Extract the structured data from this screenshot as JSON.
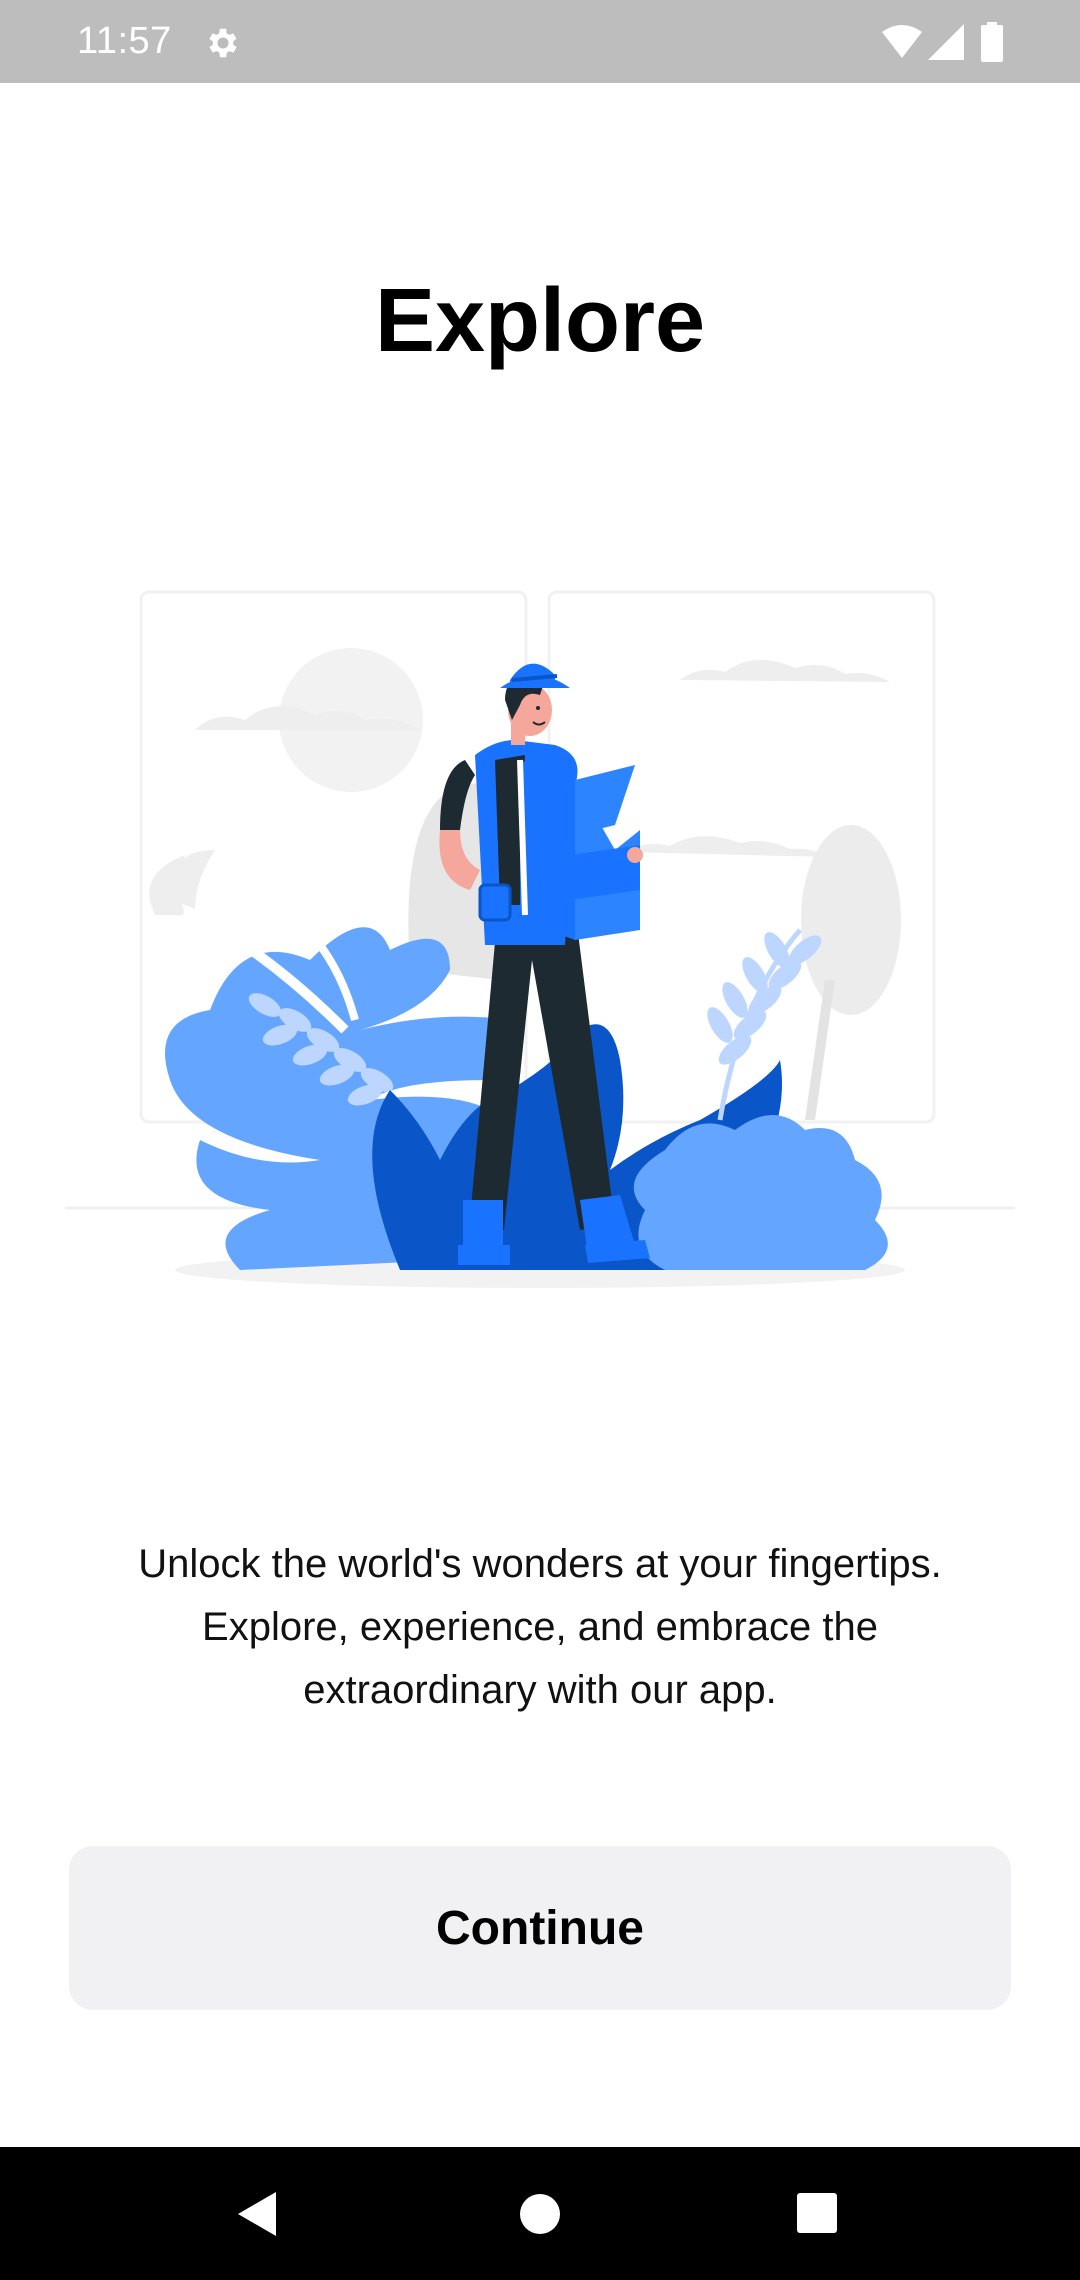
{
  "status_bar": {
    "time": "11:57",
    "icons": [
      "gear-icon",
      "wifi-icon",
      "signal-icon",
      "battery-icon"
    ]
  },
  "onboarding": {
    "title": "Explore",
    "description": "Unlock the world's wonders at your fingertips.\nExplore, experience, and embrace the\nextraordinary with our app.",
    "illustration": "traveler-reading-map-illustration",
    "continue_label": "Continue"
  },
  "nav_bar": {
    "icons": [
      "back-icon",
      "home-icon",
      "recents-icon"
    ]
  },
  "colors": {
    "status_bar_bg": "#bdbdbd",
    "accent_blue": "#1a73ff",
    "dark_blue": "#0a56c8",
    "light_blue": "#64a5ff",
    "button_bg": "#f1f1f3",
    "nav_bar_bg": "#000000"
  }
}
